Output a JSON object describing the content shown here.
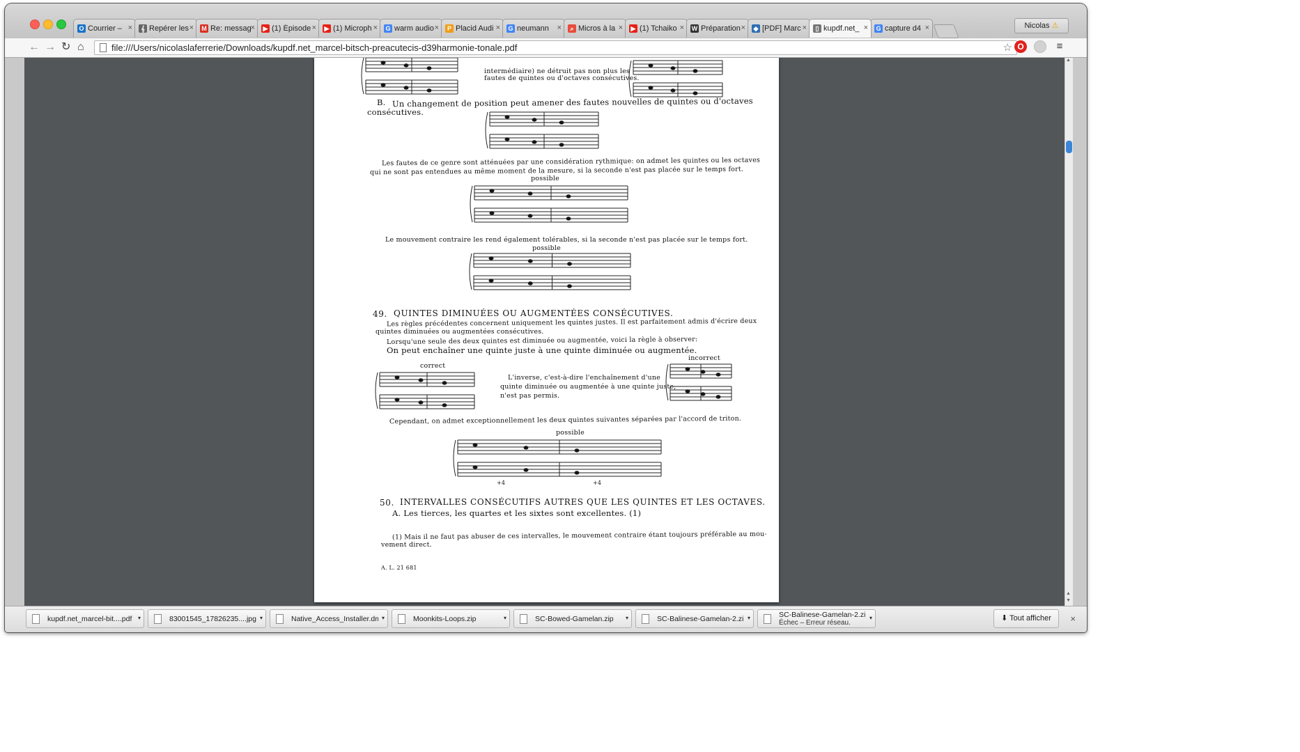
{
  "browser": {
    "tabs": [
      {
        "label": "Courrier – ",
        "icon": "outlook-icon",
        "color": "#1a73c8",
        "glyph": "O"
      },
      {
        "label": "Repérer les",
        "icon": "music-clef-icon",
        "color": "#666666",
        "glyph": "𝄞"
      },
      {
        "label": "Re: messag",
        "icon": "gmail-icon",
        "color": "#d93025",
        "glyph": "M"
      },
      {
        "label": "(1) Épisode",
        "icon": "youtube-icon",
        "color": "#e62117",
        "glyph": "▶"
      },
      {
        "label": "(1) Microph",
        "icon": "youtube-icon",
        "color": "#e62117",
        "glyph": "▶"
      },
      {
        "label": "warm audio",
        "icon": "google-icon",
        "color": "#4285f4",
        "glyph": "G"
      },
      {
        "label": "Placid Audi",
        "icon": "placid-audio-icon",
        "color": "#f39c12",
        "glyph": "P"
      },
      {
        "label": "neumann ",
        "icon": "google-icon",
        "color": "#4285f4",
        "glyph": "G"
      },
      {
        "label": "Micros à la",
        "icon": "search-icon",
        "color": "#e74c3c",
        "glyph": "⌕"
      },
      {
        "label": "(1) Tchaiko",
        "icon": "youtube-icon",
        "color": "#e62117",
        "glyph": "▶"
      },
      {
        "label": "Préparation",
        "icon": "wikipedia-icon",
        "color": "#333333",
        "glyph": "W"
      },
      {
        "label": "[PDF] Marc",
        "icon": "document-icon",
        "color": "#2f6fb5",
        "glyph": "◆"
      },
      {
        "label": "kupdf.net_",
        "icon": "page-icon",
        "color": "#777777",
        "glyph": "▯"
      },
      {
        "label": "capture d4",
        "icon": "google-icon",
        "color": "#4285f4",
        "glyph": "G"
      }
    ],
    "active_tab_index": 12,
    "profile_name": "Nicolas",
    "url": "file:///Users/nicolaslaferrerie/Downloads/kupdf.net_marcel-bitsch-preacutecis-d39harmonie-tonale.pdf",
    "back_glyph": "←",
    "forward_glyph": "→",
    "reload_glyph": "↻",
    "home_glyph": "⌂",
    "star_glyph": "☆",
    "menu_glyph": "≡",
    "close_glyph": "×"
  },
  "pdf": {
    "lines": [
      {
        "id": "top1",
        "text": "intermédiaire) ne détruit pas non plus les"
      },
      {
        "id": "top2",
        "text": "fautes de quintes ou d'octaves consécutives."
      },
      {
        "id": "B_mark",
        "text": "B."
      },
      {
        "id": "B_text",
        "text": "Un changement de position peut amener des fautes nouvelles de quintes ou  d'octaves"
      },
      {
        "id": "B_text2",
        "text": "consécutives."
      },
      {
        "id": "p1a",
        "text": "Les fautes de ce genre sont atténuées par une considération rythmique: on admet les quintes ou  les octaves"
      },
      {
        "id": "p1b",
        "text": "qui ne sont pas entendues au même moment de la mesure, si la seconde n'est pas placée sur le temps fort."
      },
      {
        "id": "possible1",
        "text": "possible"
      },
      {
        "id": "p2",
        "text": "Le mouvement contraire les rend également tolérables, si la seconde n'est pas placée sur le temps fort."
      },
      {
        "id": "possible2",
        "text": "possible"
      },
      {
        "id": "s49_num",
        "text": "49."
      },
      {
        "id": "s49_title",
        "text": "QUINTES DIMINUÉES OU AUGMENTÉES CONSÉCUTIVES."
      },
      {
        "id": "s49_a",
        "text": "Les règles précédentes concernent uniquement les quintes justes. Il est parfaitement admis d'écrire deux"
      },
      {
        "id": "s49_b",
        "text": "quintes diminuées ou augmentées consécutives."
      },
      {
        "id": "s49_c",
        "text": "Lorsqu'une seule des deux quintes est diminuée ou augmentée, voici la règle à observer:"
      },
      {
        "id": "s49_rule",
        "text": "On peut enchaîner une quinte juste à une quinte diminuée ou augmentée."
      },
      {
        "id": "correct",
        "text": "correct"
      },
      {
        "id": "incorrect",
        "text": "incorrect"
      },
      {
        "id": "inv1",
        "text": "L'inverse, c'est-à-dire l'enchaînement d'une"
      },
      {
        "id": "inv2",
        "text": "quinte diminuée ou augmentée à une quinte juste,"
      },
      {
        "id": "inv3",
        "text": "n'est pas permis."
      },
      {
        "id": "triton",
        "text": "Cependant, on admet exceptionnellement les deux quintes suivantes séparées par l'accord de triton."
      },
      {
        "id": "possible3",
        "text": "possible"
      },
      {
        "id": "plus4a",
        "text": "+4"
      },
      {
        "id": "plus4b",
        "text": "+4"
      },
      {
        "id": "s50_num",
        "text": "50."
      },
      {
        "id": "s50_title",
        "text": "INTERVALLES CONSÉCUTIFS AUTRES QUE LES QUINTES ET LES OCTAVES."
      },
      {
        "id": "s50_A",
        "text": "A. Les tierces, les quartes et les sixtes sont excellentes. (1)"
      },
      {
        "id": "fn1",
        "text": "(1)  Mais il ne faut pas abuser de ces intervalles, le mouvement contraire étant toujours préférable au mou-"
      },
      {
        "id": "fn2",
        "text": "vement direct."
      },
      {
        "id": "ref",
        "text": "A. L. 21 681"
      }
    ]
  },
  "downloads": {
    "items": [
      {
        "name": "kupdf.net_marcel-bit....pdf",
        "status": ""
      },
      {
        "name": "83001545_17826235....jpg",
        "status": ""
      },
      {
        "name": "Native_Access_Installer.dmg",
        "status": ""
      },
      {
        "name": "Moonkits-Loops.zip",
        "status": ""
      },
      {
        "name": "SC-Bowed-Gamelan.zip",
        "status": ""
      },
      {
        "name": "SC-Balinese-Gamelan-2.zip",
        "status": ""
      },
      {
        "name": "SC-Balinese-Gamelan-2.zip",
        "status": "Échec – Erreur réseau."
      }
    ],
    "show_all_label": "Tout afficher",
    "show_all_glyph": "⬇",
    "caret_glyph": "▾"
  }
}
